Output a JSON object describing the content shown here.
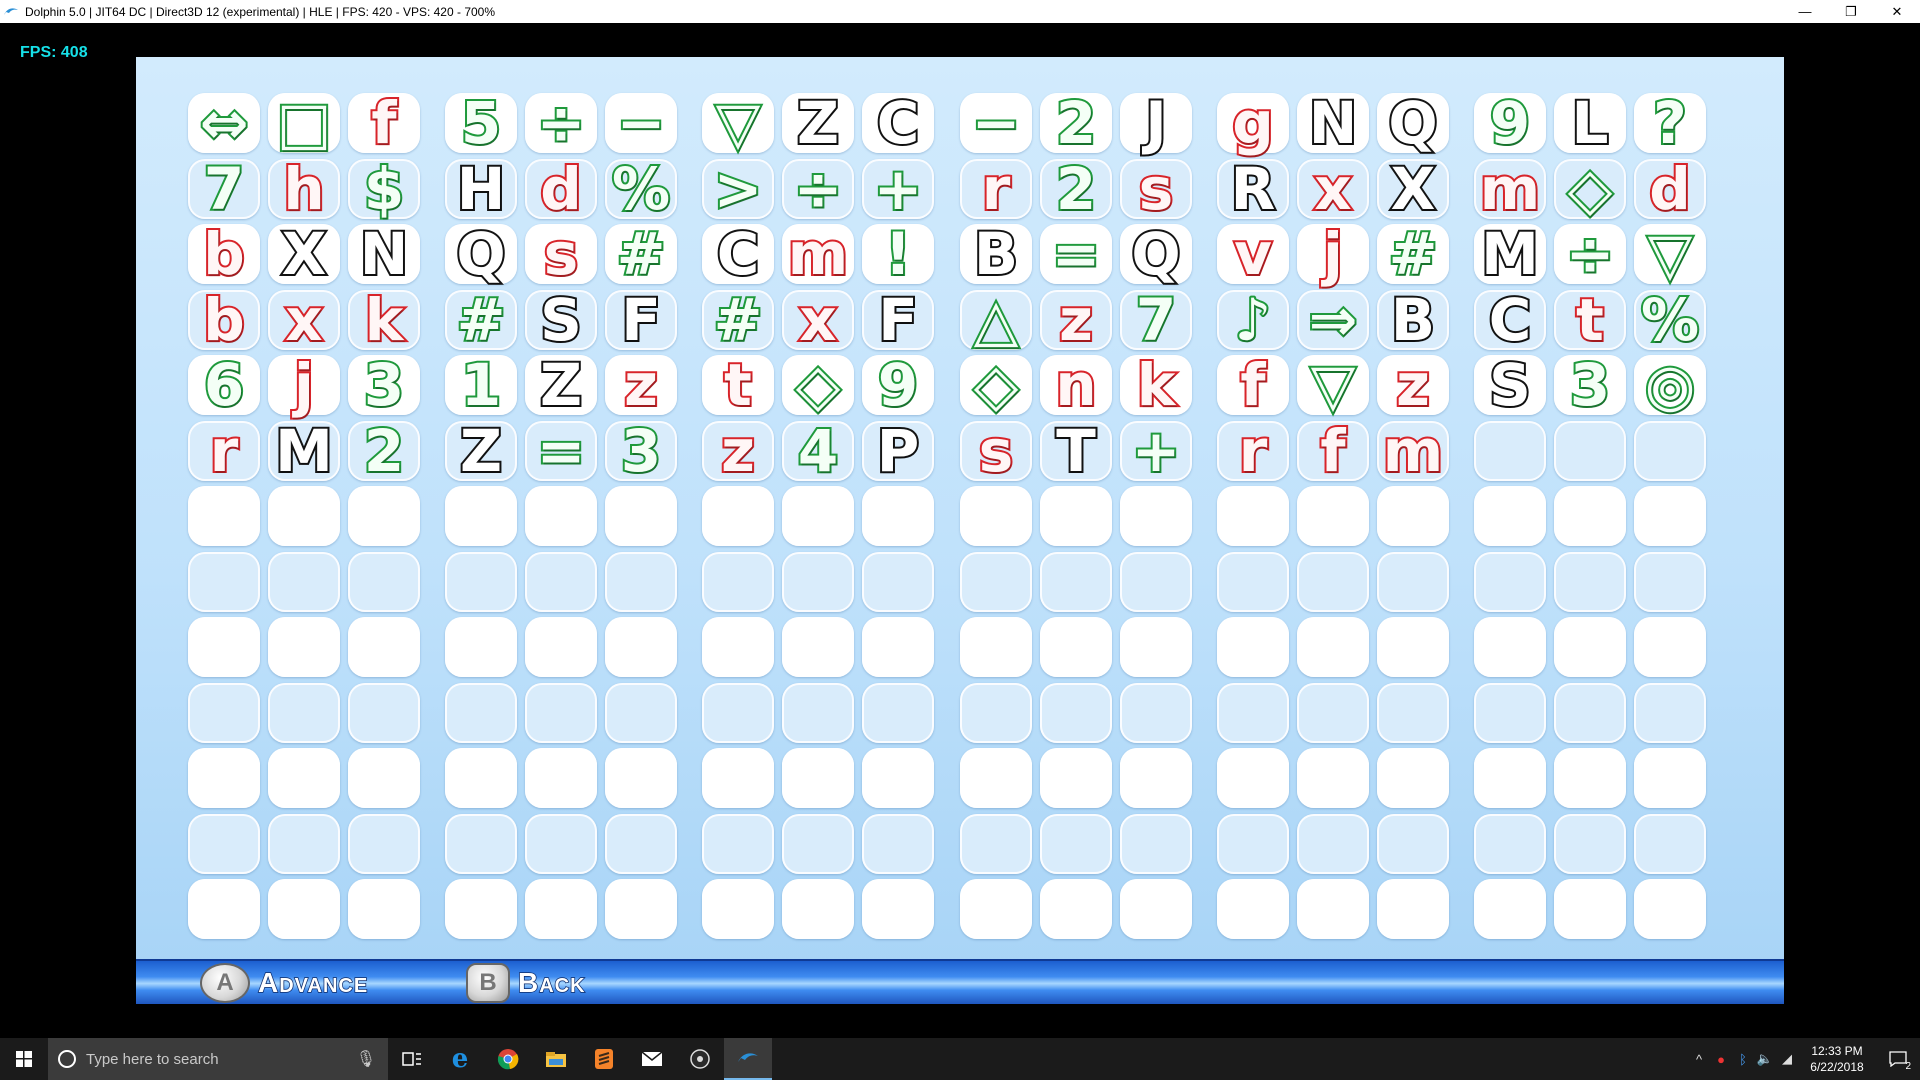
{
  "window": {
    "title": "Dolphin 5.0 | JIT64 DC | Direct3D 12 (experimental) | HLE | FPS: 420 - VPS: 420 - 700%",
    "controls": [
      "—",
      "❐",
      "✕"
    ]
  },
  "overlay": {
    "fps_text": "FPS: 408"
  },
  "grid": {
    "rows": [
      [
        [
          "⇔",
          "green"
        ],
        [
          "□",
          "green"
        ],
        [
          "f",
          "red"
        ],
        [
          "5",
          "green"
        ],
        [
          "÷",
          "green"
        ],
        [
          "−",
          "green"
        ],
        [
          "▽",
          "green"
        ],
        [
          "Z",
          "black"
        ],
        [
          "C",
          "black"
        ],
        [
          "−",
          "green"
        ],
        [
          "2",
          "green"
        ],
        [
          "J",
          "black"
        ],
        [
          "g",
          "red"
        ],
        [
          "N",
          "black"
        ],
        [
          "Q",
          "black"
        ],
        [
          "9",
          "green"
        ],
        [
          "L",
          "black"
        ],
        [
          "?",
          "green"
        ]
      ],
      [
        [
          "7",
          "green"
        ],
        [
          "h",
          "red"
        ],
        [
          "$",
          "green"
        ],
        [
          "H",
          "black"
        ],
        [
          "d",
          "red"
        ],
        [
          "%",
          "green"
        ],
        [
          ">",
          "green"
        ],
        [
          "÷",
          "green"
        ],
        [
          "+",
          "green"
        ],
        [
          "r",
          "red"
        ],
        [
          "2",
          "green"
        ],
        [
          "s",
          "red"
        ],
        [
          "R",
          "black"
        ],
        [
          "x",
          "red"
        ],
        [
          "X",
          "black"
        ],
        [
          "m",
          "red"
        ],
        [
          "◇",
          "green"
        ],
        [
          "d",
          "red"
        ]
      ],
      [
        [
          "b",
          "red"
        ],
        [
          "X",
          "black"
        ],
        [
          "N",
          "black"
        ],
        [
          "Q",
          "black"
        ],
        [
          "s",
          "red"
        ],
        [
          "#",
          "green"
        ],
        [
          "C",
          "black"
        ],
        [
          "m",
          "red"
        ],
        [
          "!",
          "green"
        ],
        [
          "B",
          "black"
        ],
        [
          "=",
          "green"
        ],
        [
          "Q",
          "black"
        ],
        [
          "v",
          "red"
        ],
        [
          "j",
          "red"
        ],
        [
          "#",
          "green"
        ],
        [
          "M",
          "black"
        ],
        [
          "÷",
          "green"
        ],
        [
          "▽",
          "green"
        ]
      ],
      [
        [
          "b",
          "red"
        ],
        [
          "x",
          "red"
        ],
        [
          "k",
          "red"
        ],
        [
          "#",
          "green"
        ],
        [
          "S",
          "black"
        ],
        [
          "F",
          "black"
        ],
        [
          "#",
          "green"
        ],
        [
          "x",
          "red"
        ],
        [
          "F",
          "black"
        ],
        [
          "△",
          "green"
        ],
        [
          "z",
          "red"
        ],
        [
          "7",
          "green"
        ],
        [
          "♪",
          "green"
        ],
        [
          "⇒",
          "green"
        ],
        [
          "B",
          "black"
        ],
        [
          "C",
          "black"
        ],
        [
          "t",
          "red"
        ],
        [
          "%",
          "green"
        ]
      ],
      [
        [
          "6",
          "green"
        ],
        [
          "j",
          "red"
        ],
        [
          "3",
          "green"
        ],
        [
          "1",
          "green"
        ],
        [
          "Z",
          "black"
        ],
        [
          "z",
          "red"
        ],
        [
          "t",
          "red"
        ],
        [
          "◇",
          "green"
        ],
        [
          "9",
          "green"
        ],
        [
          "◇",
          "green"
        ],
        [
          "n",
          "red"
        ],
        [
          "k",
          "red"
        ],
        [
          "f",
          "red"
        ],
        [
          "▽",
          "green"
        ],
        [
          "z",
          "red"
        ],
        [
          "S",
          "black"
        ],
        [
          "3",
          "green"
        ],
        [
          "◎",
          "green"
        ]
      ],
      [
        [
          "r",
          "red"
        ],
        [
          "M",
          "black"
        ],
        [
          "2",
          "green"
        ],
        [
          "Z",
          "black"
        ],
        [
          "=",
          "green"
        ],
        [
          "3",
          "green"
        ],
        [
          "z",
          "red"
        ],
        [
          "4",
          "green"
        ],
        [
          "P",
          "black"
        ],
        [
          "s",
          "red"
        ],
        [
          "T",
          "black"
        ],
        [
          "+",
          "green"
        ],
        [
          "r",
          "red"
        ],
        [
          "f",
          "red"
        ],
        [
          "m",
          "red"
        ],
        [
          "",
          ""
        ],
        [
          "",
          ""
        ],
        [
          "",
          ""
        ]
      ],
      [
        [
          "",
          ""
        ],
        [
          "",
          ""
        ],
        [
          "",
          ""
        ],
        [
          "",
          ""
        ],
        [
          "",
          ""
        ],
        [
          "",
          ""
        ],
        [
          "",
          ""
        ],
        [
          "",
          ""
        ],
        [
          "",
          ""
        ],
        [
          "",
          ""
        ],
        [
          "",
          ""
        ],
        [
          "",
          ""
        ],
        [
          "",
          ""
        ],
        [
          "",
          ""
        ],
        [
          "",
          ""
        ],
        [
          "",
          ""
        ],
        [
          "",
          ""
        ],
        [
          "",
          ""
        ]
      ],
      [
        [
          "",
          ""
        ],
        [
          "",
          ""
        ],
        [
          "",
          ""
        ],
        [
          "",
          ""
        ],
        [
          "",
          ""
        ],
        [
          "",
          ""
        ],
        [
          "",
          ""
        ],
        [
          "",
          ""
        ],
        [
          "",
          ""
        ],
        [
          "",
          ""
        ],
        [
          "",
          ""
        ],
        [
          "",
          ""
        ],
        [
          "",
          ""
        ],
        [
          "",
          ""
        ],
        [
          "",
          ""
        ],
        [
          "",
          ""
        ],
        [
          "",
          ""
        ],
        [
          "",
          ""
        ]
      ],
      [
        [
          "",
          ""
        ],
        [
          "",
          ""
        ],
        [
          "",
          ""
        ],
        [
          "",
          ""
        ],
        [
          "",
          ""
        ],
        [
          "",
          ""
        ],
        [
          "",
          ""
        ],
        [
          "",
          ""
        ],
        [
          "",
          ""
        ],
        [
          "",
          ""
        ],
        [
          "",
          ""
        ],
        [
          "",
          ""
        ],
        [
          "",
          ""
        ],
        [
          "",
          ""
        ],
        [
          "",
          ""
        ],
        [
          "",
          ""
        ],
        [
          "",
          ""
        ],
        [
          "",
          ""
        ]
      ],
      [
        [
          "",
          ""
        ],
        [
          "",
          ""
        ],
        [
          "",
          ""
        ],
        [
          "",
          ""
        ],
        [
          "",
          ""
        ],
        [
          "",
          ""
        ],
        [
          "",
          ""
        ],
        [
          "",
          ""
        ],
        [
          "",
          ""
        ],
        [
          "",
          ""
        ],
        [
          "",
          ""
        ],
        [
          "",
          ""
        ],
        [
          "",
          ""
        ],
        [
          "",
          ""
        ],
        [
          "",
          ""
        ],
        [
          "",
          ""
        ],
        [
          "",
          ""
        ],
        [
          "",
          ""
        ]
      ],
      [
        [
          "",
          ""
        ],
        [
          "",
          ""
        ],
        [
          "",
          ""
        ],
        [
          "",
          ""
        ],
        [
          "",
          ""
        ],
        [
          "",
          ""
        ],
        [
          "",
          ""
        ],
        [
          "",
          ""
        ],
        [
          "",
          ""
        ],
        [
          "",
          ""
        ],
        [
          "",
          ""
        ],
        [
          "",
          ""
        ],
        [
          "",
          ""
        ],
        [
          "",
          ""
        ],
        [
          "",
          ""
        ],
        [
          "",
          ""
        ],
        [
          "",
          ""
        ],
        [
          "",
          ""
        ]
      ],
      [
        [
          "",
          ""
        ],
        [
          "",
          ""
        ],
        [
          "",
          ""
        ],
        [
          "",
          ""
        ],
        [
          "",
          ""
        ],
        [
          "",
          ""
        ],
        [
          "",
          ""
        ],
        [
          "",
          ""
        ],
        [
          "",
          ""
        ],
        [
          "",
          ""
        ],
        [
          "",
          ""
        ],
        [
          "",
          ""
        ],
        [
          "",
          ""
        ],
        [
          "",
          ""
        ],
        [
          "",
          ""
        ],
        [
          "",
          ""
        ],
        [
          "",
          ""
        ],
        [
          "",
          ""
        ]
      ],
      [
        [
          "",
          ""
        ],
        [
          "",
          ""
        ],
        [
          "",
          ""
        ],
        [
          "",
          ""
        ],
        [
          "",
          ""
        ],
        [
          "",
          ""
        ],
        [
          "",
          ""
        ],
        [
          "",
          ""
        ],
        [
          "",
          ""
        ],
        [
          "",
          ""
        ],
        [
          "",
          ""
        ],
        [
          "",
          ""
        ],
        [
          "",
          ""
        ],
        [
          "",
          ""
        ],
        [
          "",
          ""
        ],
        [
          "",
          ""
        ],
        [
          "",
          ""
        ],
        [
          "",
          ""
        ]
      ]
    ]
  },
  "controls_bar": {
    "a_button": "A",
    "a_label": "Advance",
    "b_button": "B",
    "b_label": "Back"
  },
  "taskbar": {
    "search_placeholder": "Type here to search",
    "pinned_icons": [
      "task-view-icon",
      "edge-icon",
      "chrome-icon",
      "file-explorer-icon",
      "sublime-text-icon",
      "mail-icon",
      "obs-icon",
      "dolphin-icon"
    ],
    "clock_time": "12:33 PM",
    "clock_date": "6/22/2018",
    "notification_count": "2"
  },
  "colors": {
    "red": "#d8242a",
    "green": "#1f9a3c",
    "black": "#141414",
    "fps": "#16e0e8"
  }
}
